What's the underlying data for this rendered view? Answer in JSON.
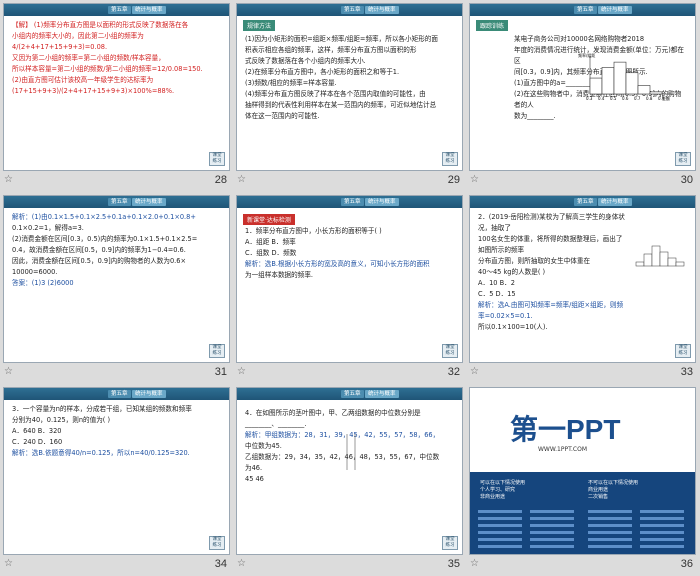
{
  "header_tab_a": "第五章",
  "header_tab_b": "统计与概率",
  "nav_label": "课堂\n练习",
  "footer_star": "☆",
  "slides": [
    {
      "page": "28",
      "lines": [
        "【解】 (1)频率分布直方图是以面积的形式反映了数据落在各",
        "小组内的频率大小的，因此第二小组的频率为",
        "4/(2+4+17+15+9+3)=0.08.",
        "又因为第二小组的频率=第二小组的频数/样本容量，",
        "所以样本容量=第二小组的频数/第二小组的频率=12/0.08=150.",
        "(2)由直方图可估计该校高一年级学生的达标率为",
        "(17+15+9+3)/(2+4+17+15+9+3)×100%=88%."
      ]
    },
    {
      "page": "29",
      "tag": "规律方法",
      "lines": [
        "(1)因为小矩形的面积=组距×频率/组距=频率，所以各小矩形的面",
        "积表示相应各组的频率，这样，频率分布直方图以面积的形",
        "式反映了数据落在各个小组内的频率大小.",
        "(2)在频率分布直方图中，各小矩形的面积之和等于1.",
        "(3)频数/相应的频率=样本容量.",
        "(4)频率分布直方图反映了样本在各个范围内取值的可能性，由",
        "抽样得到的代表性利用样本在某一范围内的频率，可近似地估计总",
        "体在这一范围内的可能性."
      ]
    },
    {
      "page": "30",
      "tag": "跟踪训练",
      "lines": [
        "某电子商务公司对10000名网络购物者2018",
        "年度的消费情况进行统计，发现消费金额(单位：万元)都在区",
        "间[0.3，0.9]内，其频率分布直方图如图所示.",
        "(1)直方图中的a=________;",
        "(2)在这些购物者中，消费金额在区间[0.5，0.9]内的购物者的人",
        "数为________."
      ],
      "chart_data": {
        "type": "bar",
        "categories": [
          "0.3",
          "0.4",
          "0.5",
          "0.6",
          "0.7",
          "0.8",
          "0.9"
        ],
        "values": [
          1.5,
          2.5,
          3.0,
          2.0,
          0.8,
          0.2
        ],
        "xlabel": "金额",
        "ylabel": "频率/组距"
      }
    },
    {
      "page": "31",
      "lines": [
        "解析：(1)由0.1×1.5+0.1×2.5+0.1a+0.1×2.0+0.1×0.8+",
        "0.1×0.2=1，解得a=3.",
        "(2)消费金额在区间[0.3，0.5)内的频率为0.1×1.5+0.1×2.5=",
        "0.4，故消费金额在区间[0.5，0.9]内的频率为1−0.4=0.6.",
        "因此，消费金额在区间[0.5，0.9]内的购物者的人数为0.6×",
        "10000=6000.",
        "答案：(1)3  (2)6000"
      ]
    },
    {
      "page": "32",
      "tag": "新课堂·达标检测",
      "lines": [
        "1．频率分布直方图中，小长方形的面积等于(    )",
        "A．组距          B．频率",
        "C．组数          D．频数",
        "解析：选B.根据小长方形的宽及高的意义，可知小长方形的面积",
        "为一组样本数据的频率."
      ]
    },
    {
      "page": "33",
      "lines": [
        "2．(2019·岳阳检测)某校为了解高三学生的身体状况，抽取了",
        "100名女生的体重，将所得的数据整理后，画出了如图所示的频率",
        "分布直方图，则所抽取的女生中体重在",
        "40～45 kg的人数是(    )",
        "A．10            B．2",
        "C．5             D．15",
        "解析：选A.由图可知频率=频率/组距×组距，则频率=0.02×5=0.1.",
        "所以0.1×100=10(人)."
      ]
    },
    {
      "page": "34",
      "lines": [
        "3．一个容量为n的样本，分成若干组，已知某组的频数和频率",
        "分别为40，0.125，则n的值为(    )",
        "A．640           B．320",
        "C．240           D．160",
        "解析：选B.依题意得40/n=0.125，所以n=40/0.125=320."
      ]
    },
    {
      "page": "35",
      "lines": [
        "4．在如图所示的茎叶图中，甲、乙两组数据的中位数分别是",
        "________、________.",
        "解析：甲组数据为：28，31，39，45，42，55，57，58，66，",
        "中位数为45.",
        "乙组数据为：29，34，35，42，46，48，53，55，67，中位数",
        "为46.",
        "45    46"
      ]
    },
    {
      "page": "36",
      "logo_title": "第一PPT",
      "logo_url": "WWW.1PPT.COM",
      "left_col": [
        "可以在以下情况使用",
        "个人学习、研究",
        "非商业用途"
      ],
      "right_col": [
        "不可以在以下情况使用",
        "商业用途",
        "二次销售"
      ]
    }
  ]
}
